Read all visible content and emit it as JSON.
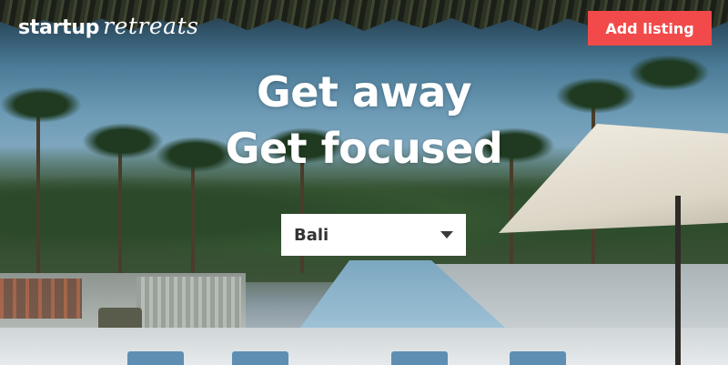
{
  "header": {
    "logo_word": "startup",
    "logo_script": "retreats",
    "add_listing_label": "Add listing"
  },
  "hero": {
    "headline_line1": "Get away",
    "headline_line2": "Get focused"
  },
  "location_select": {
    "selected": "Bali"
  },
  "colors": {
    "accent": "#f24a4a",
    "text_on_image": "#ffffff",
    "select_bg": "#ffffff",
    "select_text": "#333333"
  },
  "icons": {
    "dropdown": "chevron-down-icon"
  }
}
